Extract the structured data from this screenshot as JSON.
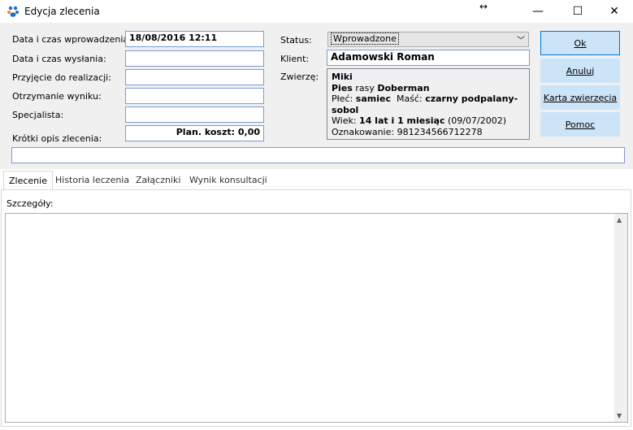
{
  "window": {
    "title": "Edycja zlecenia",
    "minimize": "—",
    "maximize": "☐",
    "close": "✕",
    "resize_glyph": "↔"
  },
  "form": {
    "entry_date_label": "Data i czas wprowadzenia:",
    "entry_date_value": "18/08/2016 12:11",
    "sent_date_label": "Data i czas wysłania:",
    "sent_date_value": "",
    "accepted_label": "Przyjęcie do realizacji:",
    "accepted_value": "",
    "result_label": "Otrzymanie wyniku:",
    "result_value": "",
    "specialist_label": "Specjalista:",
    "specialist_value": "",
    "short_desc_label": "Krótki opis zlecenia:",
    "short_desc_value": "",
    "planned_cost": "Plan. koszt: 0,00",
    "status_label": "Status:",
    "status_value": "Wprowadzone",
    "client_label": "Klient:",
    "client_value": "Adamowski Roman",
    "animal_label": "Zwierzę:"
  },
  "animal": {
    "name": "Miki",
    "species_prefix": "Pies",
    "breed_word": "rasy",
    "breed": "Doberman",
    "sex_label": "Płeć:",
    "sex": "samiec",
    "color_label": "Maść:",
    "color": "czarny podpalany-sobol",
    "age_label": "Wiek:",
    "age": "14 lat i 1 miesiąc",
    "birth": "(09/07/2002)",
    "mark_label": "Oznakowanie:",
    "mark": "981234566712278"
  },
  "buttons": {
    "ok": "Ok",
    "cancel": "Anuluj",
    "animal_card": "Karta zwierzęcia",
    "help": "Pomoc"
  },
  "tabs": [
    "Zlecenie",
    "Historia leczenia",
    "Załączniki",
    "Wynik konsultacji"
  ],
  "panel": {
    "details_label": "Szczegóły:",
    "details_value": ""
  },
  "colors": {
    "button_bg": "#cce4f7",
    "button_border": "#0078d7",
    "field_border": "#7a9cd3",
    "form_bg": "#f0f0f0"
  }
}
